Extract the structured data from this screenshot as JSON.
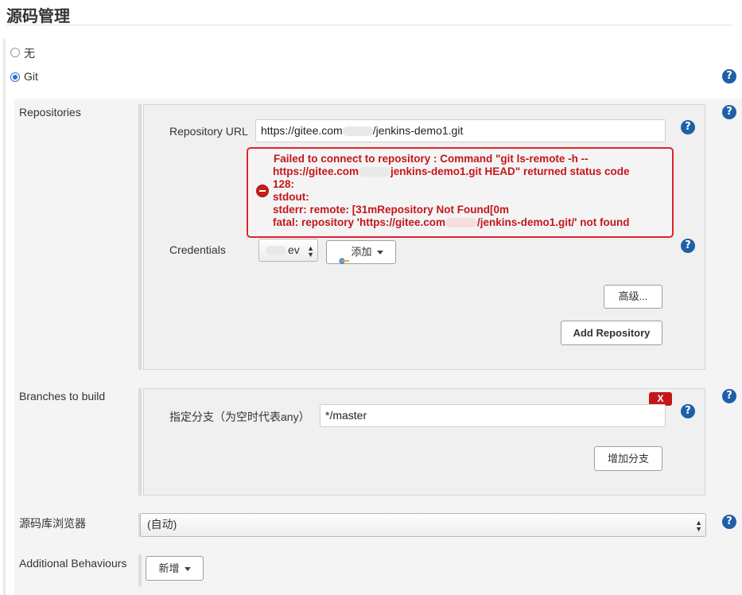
{
  "section": {
    "title": "源码管理"
  },
  "scm_options": {
    "none_label": "无",
    "git_label": "Git",
    "selected": "Git"
  },
  "repositories": {
    "label": "Repositories",
    "url_label": "Repository URL",
    "url_prefix": "https://gitee.com",
    "url_suffix": "/jenkins-demo1.git",
    "error_lines": [
      "Failed to connect to repository : Command \"git ls-remote -h --",
      "https://gitee.com",
      "jenkins-demo1.git HEAD\" returned status code",
      "128:",
      "stdout:",
      "stderr: remote: [31mRepository Not Found[0m",
      "fatal: repository 'https://gitee.com",
      "/jenkins-demo1.git/' not found"
    ],
    "credentials_label": "Credentials",
    "credentials_value": "ev",
    "add_credentials_label": "添加",
    "advanced_label": "高级...",
    "add_repository_label": "Add Repository"
  },
  "branches": {
    "label": "Branches to build",
    "branch_label": "指定分支（为空时代表any）",
    "branch_value": "*/master",
    "delete_label": "X",
    "add_branch_label": "增加分支"
  },
  "browser": {
    "label": "源码库浏览器",
    "value": "(自动)"
  },
  "behaviours": {
    "label": "Additional Behaviours",
    "add_label": "新增"
  },
  "colors": {
    "error": "#c4161c",
    "error_border": "#e0242b",
    "help": "#1f5fa8",
    "radio_selected": "#2d6fd2"
  }
}
